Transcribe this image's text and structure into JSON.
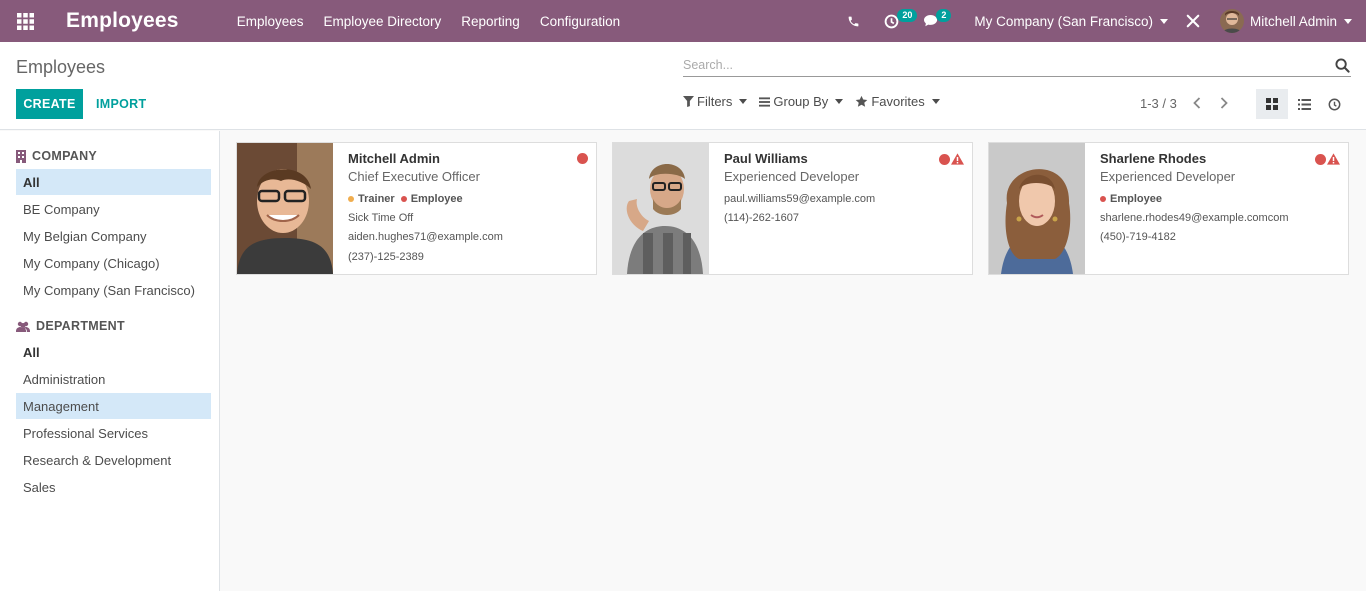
{
  "navbar": {
    "app_title": "Employees",
    "menu": [
      "Employees",
      "Employee Directory",
      "Reporting",
      "Configuration"
    ],
    "activity_count": "20",
    "message_count": "2",
    "company": "My Company (San Francisco)",
    "user": "Mitchell Admin",
    "bg_color": "#875a7b"
  },
  "control_panel": {
    "breadcrumb": "Employees",
    "search_placeholder": "Search...",
    "create_label": "CREATE",
    "import_label": "IMPORT",
    "filters_label": "Filters",
    "group_by_label": "Group By",
    "favorites_label": "Favorites",
    "pager": "1-3 / 3",
    "accent_color": "#00a09d"
  },
  "sidebar": {
    "company_header": "COMPANY",
    "companies": [
      "All",
      "BE Company",
      "My Belgian Company",
      "My Company (Chicago)",
      "My Company (San Francisco)"
    ],
    "department_header": "DEPARTMENT",
    "departments": [
      "All",
      "Administration",
      "Management",
      "Professional Services",
      "Research & Development",
      "Sales"
    ]
  },
  "employees": [
    {
      "name": "Mitchell Admin",
      "job": "Chief Executive Officer",
      "tags": [
        {
          "label": "Trainer",
          "color": "#f0ad4e"
        },
        {
          "label": "Employee",
          "color": "#d9534f"
        }
      ],
      "status_line": "Sick Time Off",
      "email": "aiden.hughes71@example.com",
      "phone": "(237)-125-2389",
      "warning": false
    },
    {
      "name": "Paul Williams",
      "job": "Experienced Developer",
      "tags": [],
      "status_line": "",
      "email": "paul.williams59@example.com",
      "phone": "(114)-262-1607",
      "warning": true
    },
    {
      "name": "Sharlene Rhodes",
      "job": "Experienced Developer",
      "tags": [
        {
          "label": "Employee",
          "color": "#d9534f"
        }
      ],
      "status_line": "",
      "email": "sharlene.rhodes49@example.comcom",
      "phone": "(450)-719-4182",
      "warning": true
    }
  ]
}
